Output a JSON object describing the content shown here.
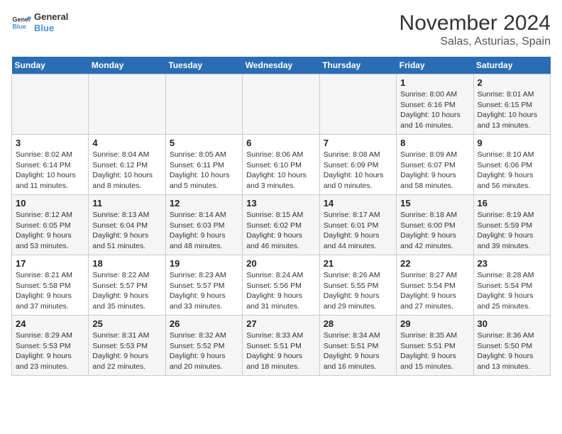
{
  "header": {
    "logo_general": "General",
    "logo_blue": "Blue",
    "title": "November 2024",
    "subtitle": "Salas, Asturias, Spain"
  },
  "weekdays": [
    "Sunday",
    "Monday",
    "Tuesday",
    "Wednesday",
    "Thursday",
    "Friday",
    "Saturday"
  ],
  "weeks": [
    [
      {
        "day": "",
        "info": ""
      },
      {
        "day": "",
        "info": ""
      },
      {
        "day": "",
        "info": ""
      },
      {
        "day": "",
        "info": ""
      },
      {
        "day": "",
        "info": ""
      },
      {
        "day": "1",
        "info": "Sunrise: 8:00 AM\nSunset: 6:16 PM\nDaylight: 10 hours and 16 minutes."
      },
      {
        "day": "2",
        "info": "Sunrise: 8:01 AM\nSunset: 6:15 PM\nDaylight: 10 hours and 13 minutes."
      }
    ],
    [
      {
        "day": "3",
        "info": "Sunrise: 8:02 AM\nSunset: 6:14 PM\nDaylight: 10 hours and 11 minutes."
      },
      {
        "day": "4",
        "info": "Sunrise: 8:04 AM\nSunset: 6:12 PM\nDaylight: 10 hours and 8 minutes."
      },
      {
        "day": "5",
        "info": "Sunrise: 8:05 AM\nSunset: 6:11 PM\nDaylight: 10 hours and 5 minutes."
      },
      {
        "day": "6",
        "info": "Sunrise: 8:06 AM\nSunset: 6:10 PM\nDaylight: 10 hours and 3 minutes."
      },
      {
        "day": "7",
        "info": "Sunrise: 8:08 AM\nSunset: 6:09 PM\nDaylight: 10 hours and 0 minutes."
      },
      {
        "day": "8",
        "info": "Sunrise: 8:09 AM\nSunset: 6:07 PM\nDaylight: 9 hours and 58 minutes."
      },
      {
        "day": "9",
        "info": "Sunrise: 8:10 AM\nSunset: 6:06 PM\nDaylight: 9 hours and 56 minutes."
      }
    ],
    [
      {
        "day": "10",
        "info": "Sunrise: 8:12 AM\nSunset: 6:05 PM\nDaylight: 9 hours and 53 minutes."
      },
      {
        "day": "11",
        "info": "Sunrise: 8:13 AM\nSunset: 6:04 PM\nDaylight: 9 hours and 51 minutes."
      },
      {
        "day": "12",
        "info": "Sunrise: 8:14 AM\nSunset: 6:03 PM\nDaylight: 9 hours and 48 minutes."
      },
      {
        "day": "13",
        "info": "Sunrise: 8:15 AM\nSunset: 6:02 PM\nDaylight: 9 hours and 46 minutes."
      },
      {
        "day": "14",
        "info": "Sunrise: 8:17 AM\nSunset: 6:01 PM\nDaylight: 9 hours and 44 minutes."
      },
      {
        "day": "15",
        "info": "Sunrise: 8:18 AM\nSunset: 6:00 PM\nDaylight: 9 hours and 42 minutes."
      },
      {
        "day": "16",
        "info": "Sunrise: 8:19 AM\nSunset: 5:59 PM\nDaylight: 9 hours and 39 minutes."
      }
    ],
    [
      {
        "day": "17",
        "info": "Sunrise: 8:21 AM\nSunset: 5:58 PM\nDaylight: 9 hours and 37 minutes."
      },
      {
        "day": "18",
        "info": "Sunrise: 8:22 AM\nSunset: 5:57 PM\nDaylight: 9 hours and 35 minutes."
      },
      {
        "day": "19",
        "info": "Sunrise: 8:23 AM\nSunset: 5:57 PM\nDaylight: 9 hours and 33 minutes."
      },
      {
        "day": "20",
        "info": "Sunrise: 8:24 AM\nSunset: 5:56 PM\nDaylight: 9 hours and 31 minutes."
      },
      {
        "day": "21",
        "info": "Sunrise: 8:26 AM\nSunset: 5:55 PM\nDaylight: 9 hours and 29 minutes."
      },
      {
        "day": "22",
        "info": "Sunrise: 8:27 AM\nSunset: 5:54 PM\nDaylight: 9 hours and 27 minutes."
      },
      {
        "day": "23",
        "info": "Sunrise: 8:28 AM\nSunset: 5:54 PM\nDaylight: 9 hours and 25 minutes."
      }
    ],
    [
      {
        "day": "24",
        "info": "Sunrise: 8:29 AM\nSunset: 5:53 PM\nDaylight: 9 hours and 23 minutes."
      },
      {
        "day": "25",
        "info": "Sunrise: 8:31 AM\nSunset: 5:53 PM\nDaylight: 9 hours and 22 minutes."
      },
      {
        "day": "26",
        "info": "Sunrise: 8:32 AM\nSunset: 5:52 PM\nDaylight: 9 hours and 20 minutes."
      },
      {
        "day": "27",
        "info": "Sunrise: 8:33 AM\nSunset: 5:51 PM\nDaylight: 9 hours and 18 minutes."
      },
      {
        "day": "28",
        "info": "Sunrise: 8:34 AM\nSunset: 5:51 PM\nDaylight: 9 hours and 16 minutes."
      },
      {
        "day": "29",
        "info": "Sunrise: 8:35 AM\nSunset: 5:51 PM\nDaylight: 9 hours and 15 minutes."
      },
      {
        "day": "30",
        "info": "Sunrise: 8:36 AM\nSunset: 5:50 PM\nDaylight: 9 hours and 13 minutes."
      }
    ]
  ]
}
